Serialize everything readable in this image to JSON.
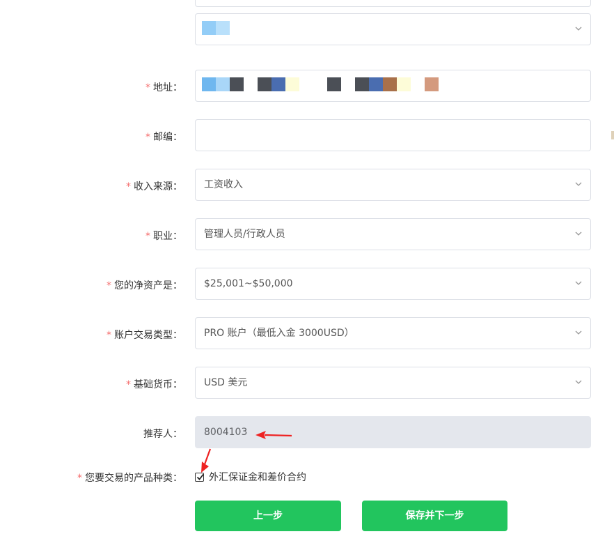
{
  "form": {
    "province_value": "",
    "address": {
      "label": "地址：",
      "required": true
    },
    "zipcode": {
      "label": "邮编：",
      "required": true,
      "value": ""
    },
    "income_source": {
      "label": "收入来源：",
      "required": true,
      "value": "工资收入"
    },
    "occupation": {
      "label": "职业：",
      "required": true,
      "value": "管理人员/行政人员"
    },
    "net_worth": {
      "label": "您的净资产是：",
      "required": true,
      "value": "$25,001~$50,000"
    },
    "account_type": {
      "label": "账户交易类型：",
      "required": true,
      "value": "PRO 账户（最低入金 3000USD）"
    },
    "base_currency": {
      "label": "基础货币：",
      "required": true,
      "value": "USD 美元"
    },
    "referrer": {
      "label": "推荐人：",
      "required": false,
      "value": "8004103"
    },
    "product_type": {
      "label": "您要交易的产品种类：",
      "required": true,
      "option_label": "外汇保证金和差价合约",
      "checked": true
    },
    "required_mark": "*"
  },
  "buttons": {
    "prev_label": "上一步",
    "save_next_label": "保存并下一步"
  },
  "colors": {
    "accent": "#22c55e",
    "required": "#f56c6c",
    "annotation_arrow": "#ee2222"
  }
}
